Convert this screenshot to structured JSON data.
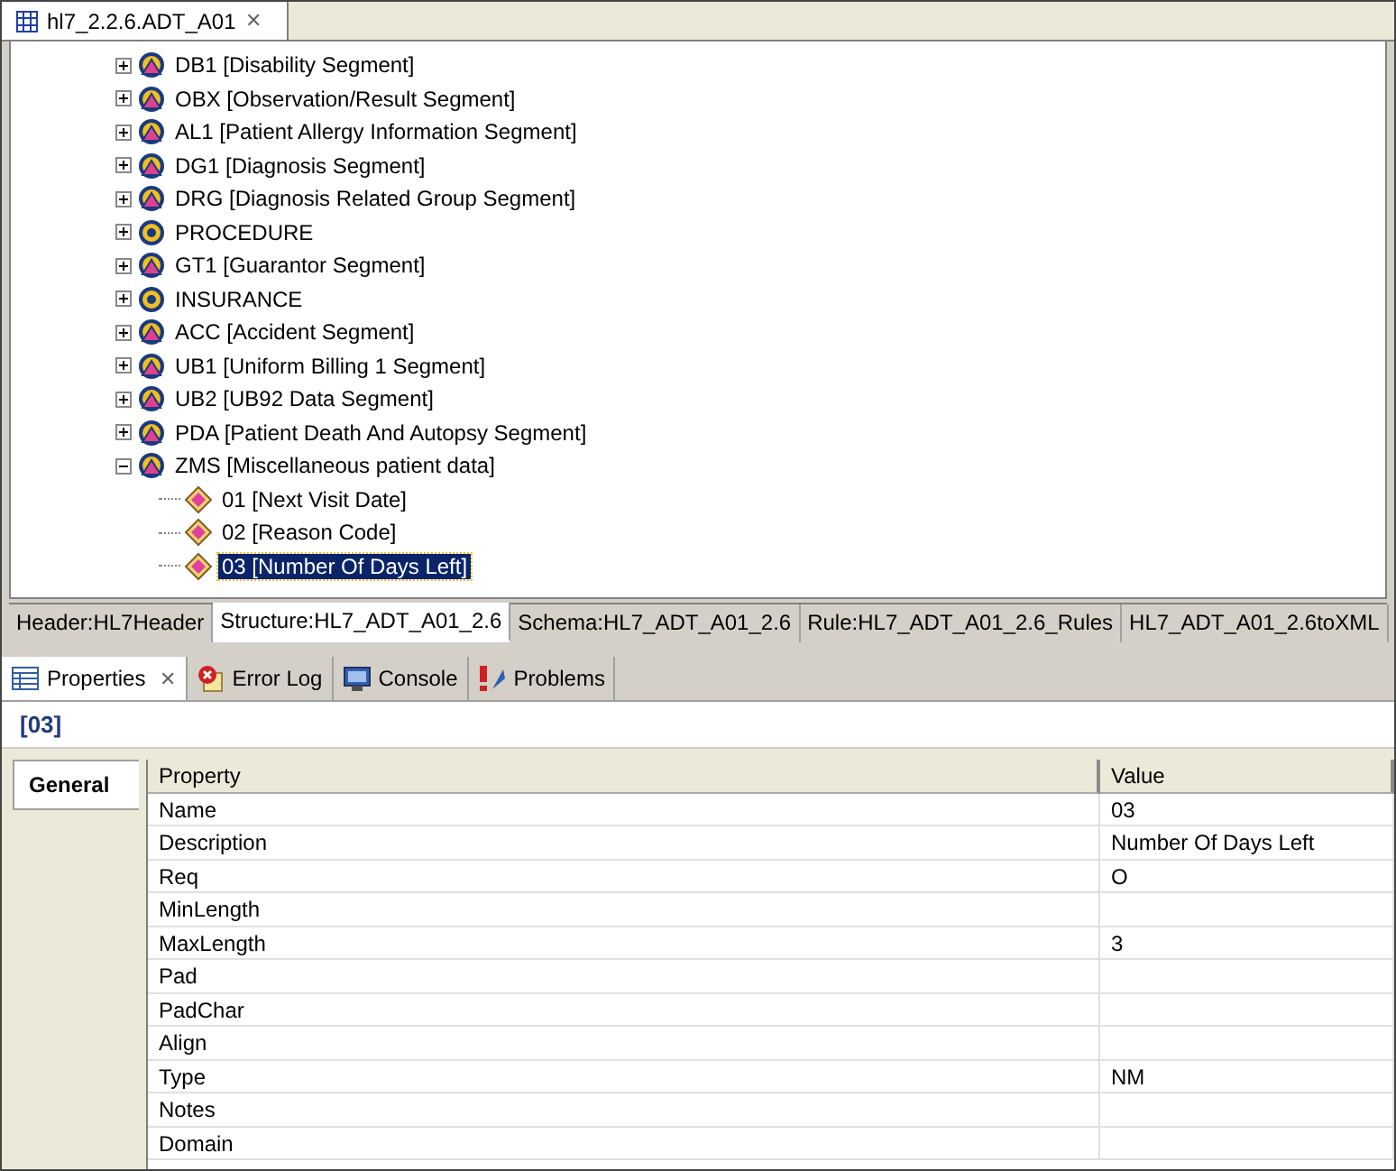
{
  "editor_tab": {
    "title": "hl7_2.2.6.ADT_A01",
    "close": "✕"
  },
  "tree": [
    {
      "kind": "segment",
      "label": "DB1 [Disability Segment]",
      "expanded": false,
      "selected": false
    },
    {
      "kind": "segment",
      "label": "OBX [Observation/Result Segment]",
      "expanded": false,
      "selected": false
    },
    {
      "kind": "segment",
      "label": "AL1 [Patient Allergy Information Segment]",
      "expanded": false,
      "selected": false
    },
    {
      "kind": "segment",
      "label": "DG1 [Diagnosis Segment]",
      "expanded": false,
      "selected": false
    },
    {
      "kind": "segment",
      "label": "DRG [Diagnosis Related Group Segment]",
      "expanded": false,
      "selected": false
    },
    {
      "kind": "group",
      "label": "PROCEDURE",
      "expanded": false,
      "selected": false
    },
    {
      "kind": "segment",
      "label": "GT1 [Guarantor Segment]",
      "expanded": false,
      "selected": false
    },
    {
      "kind": "group",
      "label": "INSURANCE",
      "expanded": false,
      "selected": false
    },
    {
      "kind": "segment",
      "label": "ACC [Accident Segment]",
      "expanded": false,
      "selected": false
    },
    {
      "kind": "segment",
      "label": "UB1 [Uniform Billing 1 Segment]",
      "expanded": false,
      "selected": false
    },
    {
      "kind": "segment",
      "label": "UB2 [UB92 Data Segment]",
      "expanded": false,
      "selected": false
    },
    {
      "kind": "segment",
      "label": "PDA [Patient Death And Autopsy Segment]",
      "expanded": false,
      "selected": false
    },
    {
      "kind": "segment",
      "label": "ZMS [Miscellaneous patient data]",
      "expanded": true,
      "selected": false,
      "children": [
        {
          "kind": "field",
          "label": "01 [Next Visit Date]",
          "selected": false
        },
        {
          "kind": "field",
          "label": "02 [Reason Code]",
          "selected": false
        },
        {
          "kind": "field",
          "label": "03 [Number Of Days Left]",
          "selected": true
        }
      ]
    }
  ],
  "editor_pages": [
    {
      "label": "Header:HL7Header",
      "selected": false
    },
    {
      "label": "Structure:HL7_ADT_A01_2.6",
      "selected": true
    },
    {
      "label": "Schema:HL7_ADT_A01_2.6",
      "selected": false
    },
    {
      "label": "Rule:HL7_ADT_A01_2.6_Rules",
      "selected": false
    },
    {
      "label": "HL7_ADT_A01_2.6toXML",
      "selected": false
    }
  ],
  "views": [
    {
      "kind": "properties",
      "label": "Properties",
      "selected": true,
      "close": "✕"
    },
    {
      "kind": "errorlog",
      "label": "Error Log",
      "selected": false
    },
    {
      "kind": "console",
      "label": "Console",
      "selected": false
    },
    {
      "kind": "problems",
      "label": "Problems",
      "selected": false
    }
  ],
  "properties": {
    "title": "[03]",
    "sections": [
      {
        "label": "General",
        "selected": true
      }
    ],
    "columns": [
      "Property",
      "Value"
    ],
    "rows": [
      {
        "property": "Name",
        "value": "03"
      },
      {
        "property": "Description",
        "value": "Number Of Days Left"
      },
      {
        "property": "Req",
        "value": "O"
      },
      {
        "property": "MinLength"
      },
      {
        "property": "MaxLength",
        "value": "3"
      },
      {
        "property": "Pad"
      },
      {
        "property": "PadChar"
      },
      {
        "property": "Align"
      },
      {
        "property": "Type",
        "value": "NM"
      },
      {
        "property": "Notes"
      },
      {
        "property": "Domain"
      }
    ]
  }
}
